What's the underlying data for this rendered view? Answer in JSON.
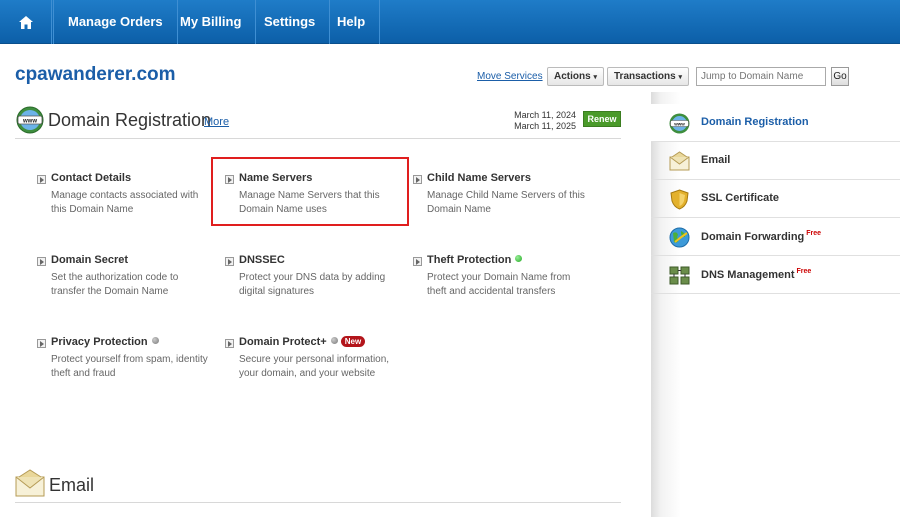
{
  "nav": {
    "home_icon": "home-icon",
    "items": [
      "Manage Orders",
      "My Billing",
      "Settings",
      "Help"
    ]
  },
  "header": {
    "domain": "cpawanderer.com",
    "move_services": "Move Services",
    "actions": "Actions",
    "transactions": "Transactions",
    "jump_placeholder": "Jump to Domain Name",
    "go": "Go"
  },
  "domain_registration": {
    "title": "Domain Registration",
    "more": "More",
    "date1": "March 11, 2024",
    "date2": "March 11, 2025",
    "renew": "Renew",
    "items": [
      {
        "title": "Contact Details",
        "desc": "Manage contacts associated with this Domain Name"
      },
      {
        "title": "Name Servers",
        "desc": "Manage Name Servers that this Domain Name uses"
      },
      {
        "title": "Child Name Servers",
        "desc": "Manage Child Name Servers of this Domain Name"
      },
      {
        "title": "Domain Secret",
        "desc": "Set the authorization code to transfer the Domain Name"
      },
      {
        "title": "DNSSEC",
        "desc": "Protect your DNS data by adding digital signatures"
      },
      {
        "title": "Theft Protection",
        "desc": "Protect your Domain Name from theft and accidental transfers"
      },
      {
        "title": "Privacy Protection",
        "desc": "Protect yourself from spam, identity theft and fraud"
      },
      {
        "title": "Domain Protect+",
        "desc": "Secure your personal information, your domain, and your website",
        "badge": "New"
      }
    ]
  },
  "email_section": {
    "title": "Email"
  },
  "sidebar": {
    "items": [
      {
        "label": "Domain Registration",
        "icon": "www-globe-icon"
      },
      {
        "label": "Email",
        "icon": "envelope-icon"
      },
      {
        "label": "SSL Certificate",
        "icon": "shield-icon"
      },
      {
        "label": "Domain Forwarding",
        "icon": "forwarding-globe-icon",
        "free": "Free"
      },
      {
        "label": "DNS Management",
        "icon": "server-icon",
        "free": "Free"
      }
    ]
  },
  "colors": {
    "nav_bg": "#1466b4",
    "link": "#1b5ea8",
    "renew": "#4a9a2a",
    "highlight": "#e01e1e",
    "new_badge": "#b3151b"
  }
}
